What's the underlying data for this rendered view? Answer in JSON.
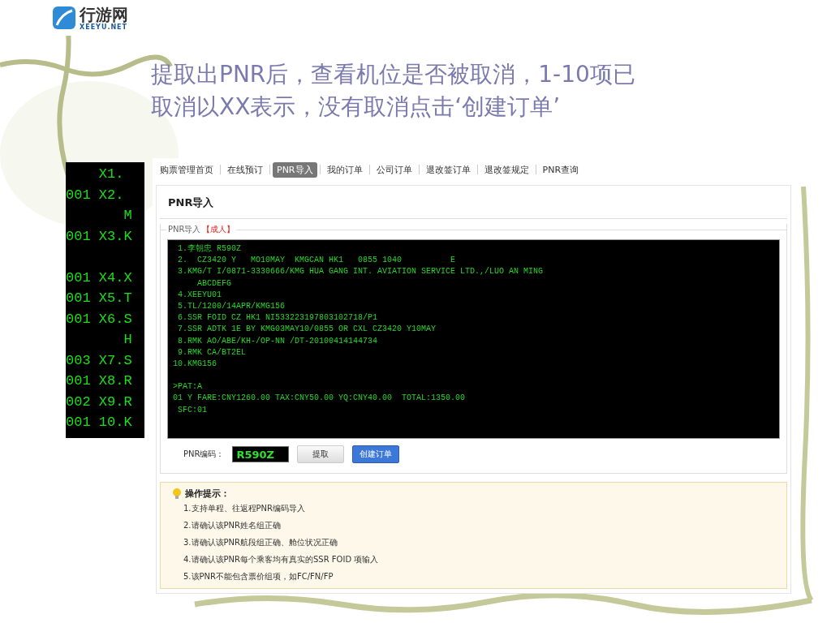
{
  "logo": {
    "name": "行游网",
    "domain": "XEEYU.NET"
  },
  "title": [
    "提取出PNR后，查看机位是否被取消，1-10项已",
    "取消以XX表示，没有取消点击‘创建订单’"
  ],
  "terminal_strip": {
    "groups": [
      [
        "    X1.",
        "001 X2.",
        "       M",
        "001 X3.K"
      ],
      [
        "001 X4.X",
        "001 X5.T",
        "001 X6.S",
        "       H",
        "003 X7.S",
        "001 X8.R",
        "002 X9.R",
        "001 10.K"
      ]
    ]
  },
  "nav": {
    "tabs": [
      {
        "label": "购票管理首页",
        "selected": false
      },
      {
        "label": "在线预订",
        "selected": false
      },
      {
        "label": "PNR导入",
        "selected": true
      },
      {
        "label": "我的订单",
        "selected": false
      },
      {
        "label": "公司订单",
        "selected": false
      },
      {
        "label": "退改签订单",
        "selected": false
      },
      {
        "label": "退改签规定",
        "selected": false
      },
      {
        "label": "PNR查询",
        "selected": false
      }
    ]
  },
  "panel": {
    "title": "PNR导入",
    "fieldset_label": "PNR导入",
    "fieldset_tag": "【成人】",
    "terminal": {
      "groups": [
        [
          " 1.李朝忠 R590Z",
          " 2.  CZ3420 Y   MO10MAY  KMGCAN HK1   0855 1040          E",
          " 3.KMG/T I/0871-3330666/KMG HUA GANG INT. AVIATION SERVICE LTD.,/LUO AN MING",
          "     ABCDEFG",
          " 4.XEEYU01",
          " 5.TL/1200/14APR/KMG156",
          " 6.SSR FOID CZ HK1 NI533223197803102718/P1",
          " 7.SSR ADTK 1E BY KMG03MAY10/0855 OR CXL CZ3420 Y10MAY",
          " 8.RMK AO/ABE/KH-/OP-NN /DT-20100414144734",
          " 9.RMK CA/BT2EL",
          "10.KMG156"
        ],
        [
          ">PAT:A",
          "01 Y FARE:CNY1260.00 TAX:CNY50.00 YQ:CNY40.00  TOTAL:1350.00",
          " SFC:01"
        ]
      ]
    },
    "code_label": "PNR编码：",
    "code_value": "R590Z",
    "buttons": [
      {
        "label": "提取",
        "kind": "plain"
      },
      {
        "label": "创建订单",
        "kind": "primary"
      }
    ]
  },
  "tips": {
    "title": "操作提示：",
    "items": [
      "1.支持单程、往返程PNR编码导入",
      "2.请确认该PNR姓名组正确",
      "3.请确认该PNR航段组正确、舱位状况正确",
      "4.请确认该PNR每个乘客均有真实的SSR FOID 项输入",
      "5.该PNR不能包含票价组项，如FC/FN/FP"
    ]
  }
}
